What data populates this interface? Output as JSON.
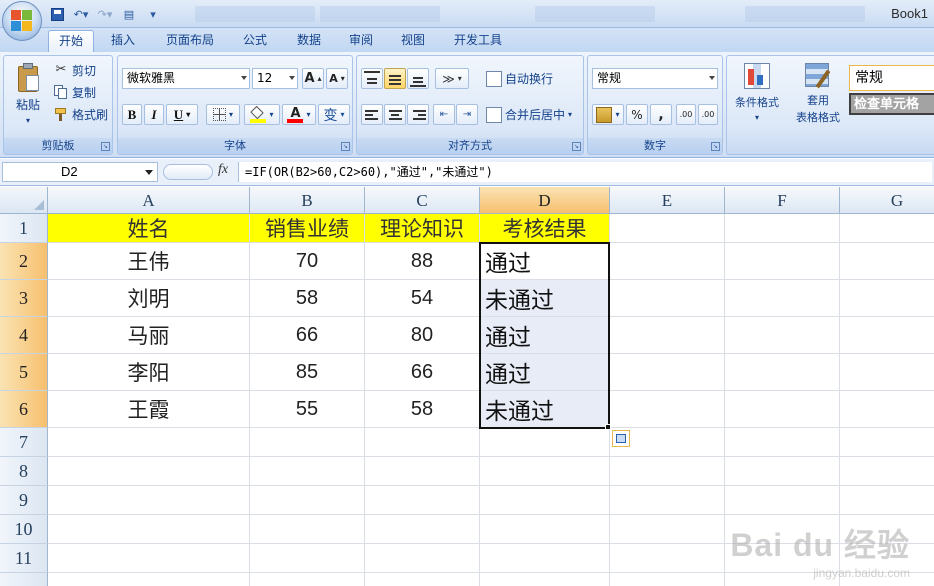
{
  "window": {
    "title": "Book1"
  },
  "tabs": [
    "开始",
    "插入",
    "页面布局",
    "公式",
    "数据",
    "审阅",
    "视图",
    "开发工具"
  ],
  "active_tab": "开始",
  "ribbon": {
    "clipboard": {
      "label": "剪贴板",
      "paste": "粘贴",
      "cut": "剪切",
      "copy": "复制",
      "format_painter": "格式刷"
    },
    "font": {
      "label": "字体",
      "name": "微软雅黑",
      "size": "12",
      "bold": "B",
      "italic": "I",
      "underline": "U",
      "grow": "A",
      "shrink": "A",
      "font_color_glyph": "A",
      "phonetic": "变"
    },
    "alignment": {
      "label": "对齐方式",
      "wrap_text": "自动换行",
      "merge_center": "合并后居中"
    },
    "number": {
      "label": "数字",
      "format": "常规",
      "percent": "%",
      "comma": ",",
      "inc_decimal": ".00",
      "dec_decimal": ".00"
    },
    "styles": {
      "conditional_format": "条件格式",
      "format_table_line1": "套用",
      "format_table_line2": "表格格式",
      "cell_style_normal": "常规",
      "cell_style_check": "检查单元格"
    }
  },
  "formula_bar": {
    "name_box": "D2",
    "fx": "fx",
    "formula": "=IF(OR(B2>60,C2>60),\"通过\",\"未通过\")"
  },
  "sheet": {
    "columns": [
      "A",
      "B",
      "C",
      "D",
      "E",
      "F",
      "G"
    ],
    "rows": [
      "1",
      "2",
      "3",
      "4",
      "5",
      "6",
      "7",
      "8",
      "9",
      "10",
      "11"
    ],
    "header": [
      "姓名",
      "销售业绩",
      "理论知识",
      "考核结果"
    ],
    "data": [
      [
        "王伟",
        "70",
        "88",
        "通过"
      ],
      [
        "刘明",
        "58",
        "54",
        "未通过"
      ],
      [
        "马丽",
        "66",
        "80",
        "通过"
      ],
      [
        "李阳",
        "85",
        "66",
        "通过"
      ],
      [
        "王霞",
        "55",
        "58",
        "未通过"
      ]
    ],
    "selected_range": "D2:D6"
  },
  "watermark": {
    "main": "Bai du 经验",
    "sub": "jingyan.baidu.com"
  }
}
